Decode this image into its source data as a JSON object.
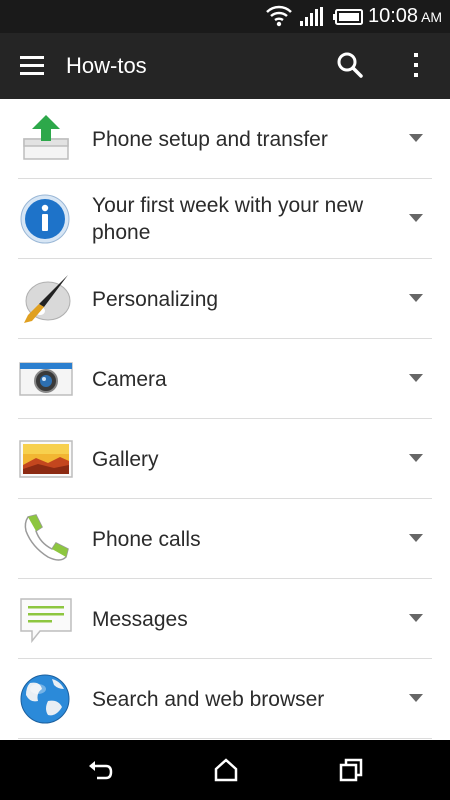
{
  "status_bar": {
    "time": "10:08",
    "ampm": "AM",
    "icons": [
      "wifi-icon",
      "signal-icon",
      "battery-icon"
    ]
  },
  "app_bar": {
    "title": "How-tos",
    "icons": [
      "menu-icon",
      "search-icon",
      "more-vert-icon"
    ]
  },
  "items": [
    {
      "label": "Phone setup and transfer",
      "icon": "phone-setup-icon"
    },
    {
      "label": "Your first week with your new phone",
      "icon": "info-icon"
    },
    {
      "label": "Personalizing",
      "icon": "paintbrush-icon"
    },
    {
      "label": "Camera",
      "icon": "camera-icon"
    },
    {
      "label": "Gallery",
      "icon": "gallery-icon"
    },
    {
      "label": "Phone calls",
      "icon": "phone-icon"
    },
    {
      "label": "Messages",
      "icon": "message-icon"
    },
    {
      "label": "Search and web browser",
      "icon": "globe-icon"
    }
  ],
  "nav_bar": {
    "icons": [
      "back-icon",
      "home-icon",
      "recent-apps-icon"
    ]
  },
  "colors": {
    "app_bar": "#252525",
    "status_bar": "#1a1a1a",
    "accent_green": "#8dc63f"
  }
}
